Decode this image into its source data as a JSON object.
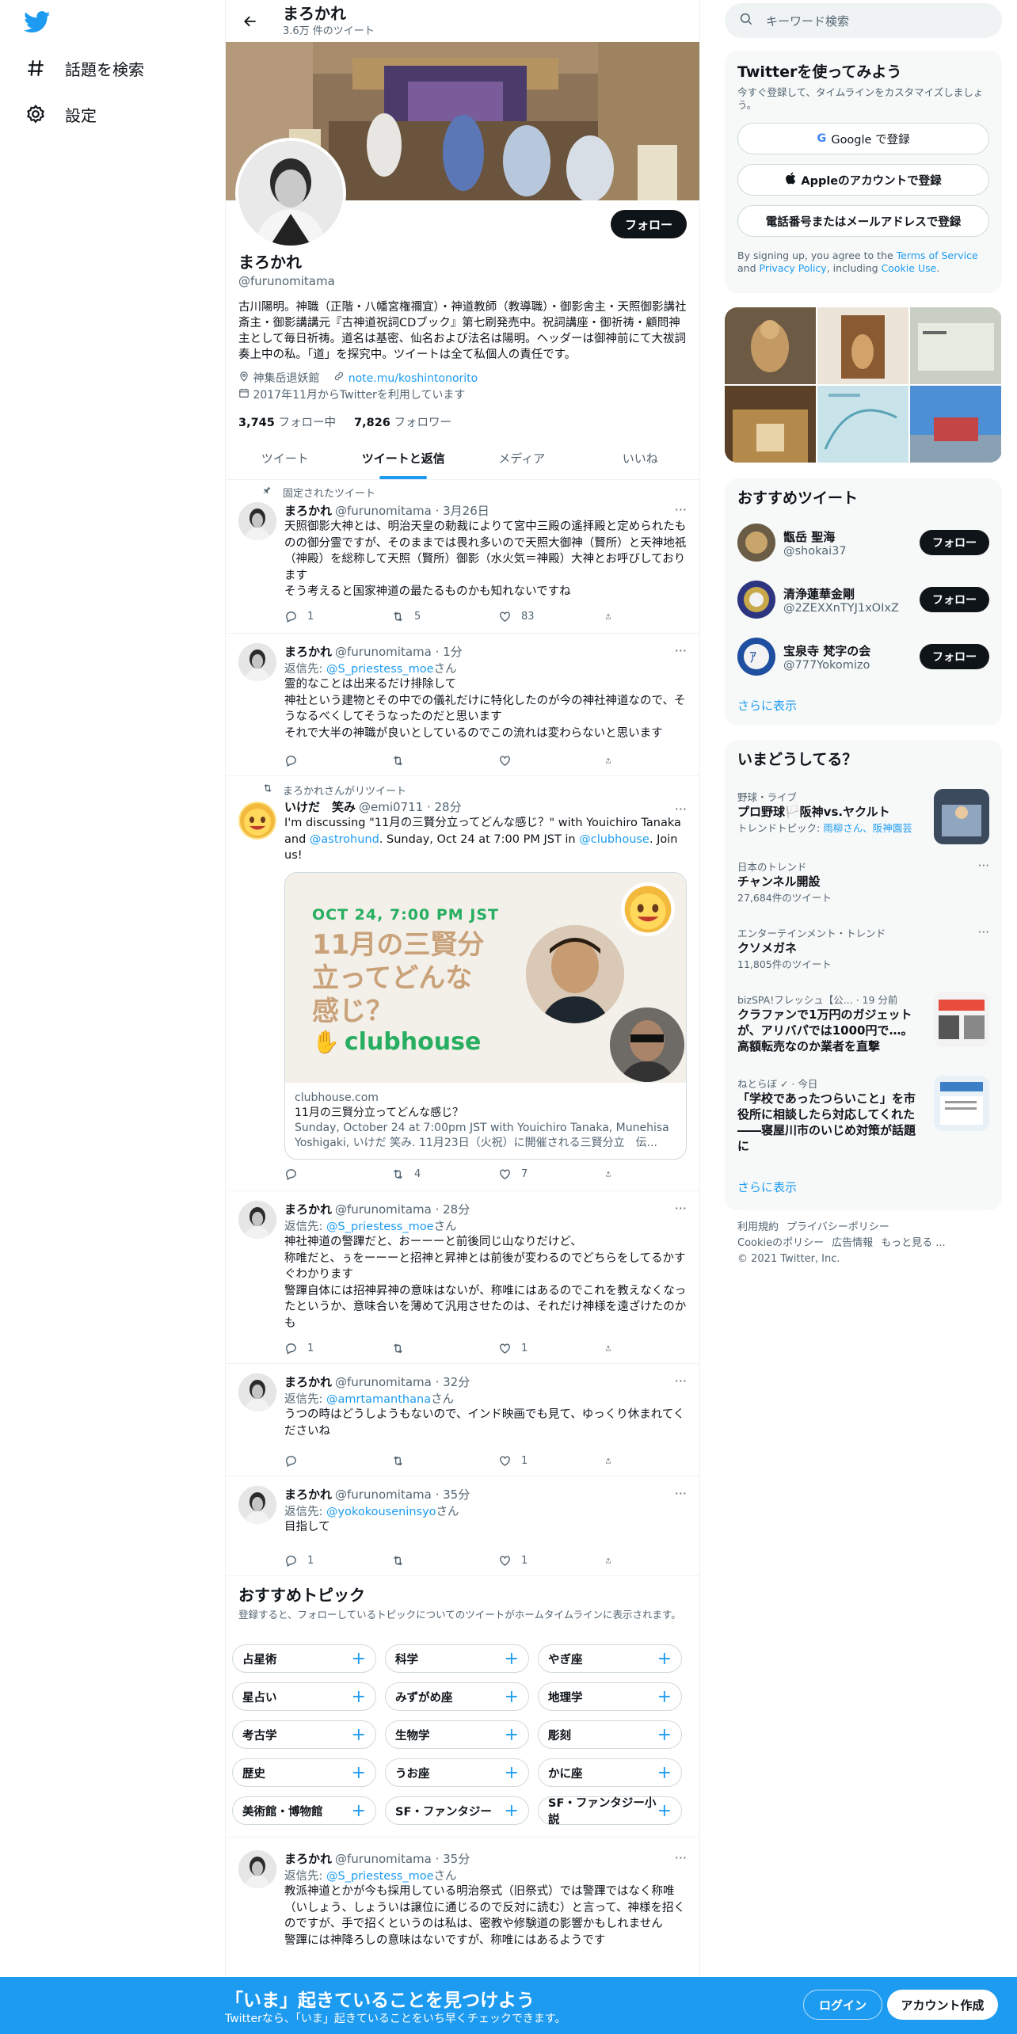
{
  "nav": {
    "explore_label": "話題を検索",
    "settings_label": "設定"
  },
  "profile": {
    "topbar_name": "まろかれ",
    "tweet_count": "3.6万 件のツイート",
    "name": "まろかれ",
    "handle": "@furunomitama",
    "follow_label": "フォロー",
    "bio": "古川陽明。神職（正階・八幡宮権禰宜）・神道教師（教導職）・御影舍主・天照御影講社斎主・御影講講元『古神道祝詞CDブック』第七刷発売中。祝詞講座・御祈祷・顧問神主として毎日祈祷。道名は基密、仙名および法名は陽明。ヘッダーは御神前にて大祓詞奏上中の私。「道」を探究中。ツイートは全て私個人の責任です。",
    "location": "神集岳退妖館",
    "link": "note.mu/koshintonorito",
    "joined": "2017年11月からTwitterを利用しています",
    "following_count": "3,745",
    "following_label": "フォロー中",
    "followers_count": "7,826",
    "followers_label": "フォロワー"
  },
  "tabs": [
    "ツイート",
    "ツイートと返信",
    "メディア",
    "いいね"
  ],
  "tweets": [
    {
      "context": "固定されたツイート",
      "name": "まろかれ",
      "meta": "@furunomitama · 3月26日",
      "reply_to": "",
      "text": "天照御影大神とは、明治天皇の勅裁によりて宮中三殿の遙拝殿と定められたものの御分霊ですが、そのままでは畏れ多いので天照大御神（賢所）と天神地祇（神殿）を総称して天照（賢所）御影（水火気＝神殿）大神とお呼びしております\nそう考えると国家神道の最たるものかも知れないですね",
      "replies": "1",
      "retweets": "5",
      "likes": "83"
    },
    {
      "context": "",
      "name": "まろかれ",
      "meta": "@furunomitama · 1分",
      "reply_prefix": "返信先: ",
      "reply_to": "@S_priestess_moe",
      "reply_suffix": "さん",
      "text": "霊的なことは出来るだけ排除して\n神社という建物とその中での儀礼だけに特化したのが今の神社神道なので、そうなるべくしてそうなったのだと思います\nそれで大半の神職が良いとしているのでこの流れは変わらないと思います",
      "replies": "",
      "retweets": "",
      "likes": ""
    },
    {
      "context": "まろかれさんがリツイート",
      "name": "いけだ　笑み",
      "meta": "@emi0711 · 28分",
      "text_a": "I'm discussing \"11月の三賢分立ってどんな感じ？\" with Youichiro Tanaka and ",
      "mention1": "@astrohund",
      "text_b": ". Sunday, Oct 24 at 7:00 PM JST in ",
      "mention2": "@clubhouse",
      "text_c": ". Join us!",
      "card_date": "OCT 24, 7:00 PM JST",
      "card_headline": "11月の三賢分立ってどんな感じ？",
      "card_brand": "clubhouse",
      "card_domain": "clubhouse.com",
      "card_title": "11月の三賢分立ってどんな感じ？",
      "card_desc": "Sunday, October 24 at 7:00pm JST with Youichiro Tanaka, Munehisa Yoshigaki, いけだ 笑み. 11月23日（火祝）に開催される三賢分立　伝...",
      "replies": "",
      "retweets": "4",
      "likes": "7"
    },
    {
      "name": "まろかれ",
      "meta": "@furunomitama · 28分",
      "reply_prefix": "返信先: ",
      "reply_to": "@S_priestess_moe",
      "reply_suffix": "さん",
      "text": "神社神道の警蹕だと、おーーーと前後同じ山なりだけど、\n称唯だと、ぅをーーーと招神と昇神とは前後が変わるのでどちらをしてるかすぐわかります\n警蹕自体には招神昇神の意味はないが、称唯にはあるのでこれを教えなくなったというか、意味合いを薄めて汎用させたのは、それだけ神様を遠ざけたのかも",
      "replies": "1",
      "retweets": "",
      "likes": "1"
    },
    {
      "name": "まろかれ",
      "meta": "@furunomitama · 32分",
      "reply_prefix": "返信先: ",
      "reply_to": "@amrtamanthana",
      "reply_suffix": "さん",
      "text": "うつの時はどうしようもないので、インド映画でも見て、ゆっくり休まれてくださいね",
      "replies": "",
      "retweets": "",
      "likes": "1"
    },
    {
      "name": "まろかれ",
      "meta": "@furunomitama · 35分",
      "reply_prefix": "返信先: ",
      "reply_to": "@yokokouseninsyo",
      "reply_suffix": "さん",
      "text": "目指して",
      "replies": "1",
      "retweets": "",
      "likes": "1"
    },
    {
      "name": "まろかれ",
      "meta": "@furunomitama · 35分",
      "reply_prefix": "返信先: ",
      "reply_to": "@S_priestess_moe",
      "reply_suffix": "さん",
      "text": "教派神道とかが今も採用している明治祭式（旧祭式）では警蹕ではなく称唯（いしょう、しょういは譲位に通じるので反対に読む）と言って、神様を招くのですが、手で招くというのは私は、密教や修験道の影響かもしれません\n警蹕には神降ろしの意味はないですが、称唯にはあるようです"
    }
  ],
  "topics": {
    "title": "おすすめトピック",
    "subtitle": "登録すると、フォローしているトピックについてのツイートがホームタイムラインに表示されます。",
    "items": [
      "占星術",
      "科学",
      "やぎ座",
      "星占い",
      "みずがめ座",
      "地理学",
      "考古学",
      "生物学",
      "彫刻",
      "歴史",
      "うお座",
      "かに座",
      "美術館・博物館",
      "SF・ファンタジー",
      "SF・ファンタジー小説"
    ]
  },
  "right": {
    "search_placeholder": "キーワード検索",
    "signup_title": "Twitterを使ってみよう",
    "signup_sub": "今すぐ登録して、タイムラインをカスタマイズしましょう。",
    "google_btn": "Google で登録",
    "apple_btn": "Appleのアカウントで登録",
    "phone_btn": "電話番号またはメールアドレスで登録",
    "terms_a": "By signing up, you agree to the ",
    "terms_link1": "Terms of Service",
    "terms_b": " and ",
    "terms_link2": "Privacy Policy",
    "terms_c": ", including ",
    "terms_link3": "Cookie Use",
    "terms_d": ".",
    "who_title": "おすすめツイート",
    "who": [
      {
        "name": "甑岳 聖海",
        "handle": "@shokai37",
        "btn": "フォロー"
      },
      {
        "name": "清浄蓮華金剛",
        "handle": "@2ZEXXnTYJ1xOIxZ",
        "btn": "フォロー"
      },
      {
        "name": "宝泉寺 梵字の会",
        "handle": "@777Yokomizo",
        "btn": "フォロー"
      }
    ],
    "who_more": "さらに表示",
    "trends_title": "いまどうしてる？",
    "trends": [
      {
        "cat": "野球・ライブ",
        "title": "プロ野球🏳️阪神vs.ヤクルト",
        "sub_pre": "トレンドトピック: ",
        "sub_link": "雨柳さん、阪神園芸"
      },
      {
        "cat": "日本のトレンド",
        "title": "チャンネル開設",
        "sub": "27,684件のツイート"
      },
      {
        "cat": "エンターテインメント・トレンド",
        "title": "クソメガネ",
        "sub": "11,805件のツイート"
      },
      {
        "cat": "bizSPA!フレッシュ【公... · 19 分前",
        "title": "クラファンで1万円のガジェットが、アリバパでは1000円で…。高額転売なのか業者を直撃"
      },
      {
        "cat": "ねとらぼ ✓ · 今日",
        "title": "「学校であったつらいこと」を市役所に相談したら対応してくれた――寝屋川市のいじめ対策が話題に"
      }
    ],
    "trends_more": "さらに表示",
    "footer": [
      "利用規約",
      "プライバシーポリシー",
      "Cookieのポリシー",
      "広告情報",
      "もっと見る ...",
      "© 2021 Twitter, Inc."
    ]
  },
  "bottom": {
    "title": "「いま」起きていることを見つけよう",
    "sub": "Twitterなら、「いま」起きていることをいち早くチェックできます。",
    "login": "ログイン",
    "signup": "アカウント作成"
  },
  "colors": {
    "accent": "#1d9bf0",
    "text": "#0f1419",
    "muted": "#536471"
  }
}
